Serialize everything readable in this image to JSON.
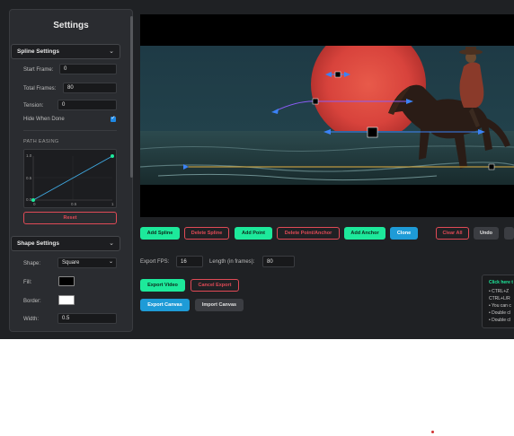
{
  "sidebar": {
    "title": "Settings",
    "spline_settings": {
      "header": "Spline Settings",
      "start_frame_label": "Start Frame:",
      "start_frame_value": "0",
      "total_frames_label": "Total Frames:",
      "total_frames_value": "80",
      "tension_label": "Tension:",
      "tension_value": "0",
      "hide_when_done_label": "Hide When Done",
      "path_easing_label": "PATH EASING",
      "graph_y_ticks": [
        "1.0",
        "0.5",
        "0.0"
      ],
      "graph_x_ticks": [
        "0",
        "0.5",
        "1"
      ],
      "easing_start": [
        0,
        0
      ],
      "easing_end": [
        1,
        1
      ],
      "reset_label": "Reset"
    },
    "shape_settings": {
      "header": "Shape Settings",
      "shape_label": "Shape:",
      "shape_value": "Square",
      "fill_label": "Fill:",
      "fill_color": "#000000",
      "border_label": "Border:",
      "border_color": "#ffffff",
      "width_label": "Width:",
      "width_value": "0.5"
    }
  },
  "toolbar": {
    "add_spline": "Add Spline",
    "delete_spline": "Delete Spline",
    "add_point": "Add Point",
    "delete_point_anchor": "Delete Point/Anchor",
    "add_anchor": "Add Anchor",
    "clone": "Clone",
    "clear_all": "Clear All",
    "undo": "Undo"
  },
  "export": {
    "fps_label": "Export FPS:",
    "fps_value": "16",
    "length_label": "Length (in frames):",
    "length_value": "80",
    "export_video": "Export Video",
    "cancel_export": "Cancel Export",
    "export_canvas": "Export Canvas",
    "import_canvas": "Import Canvas"
  },
  "help": {
    "heading": "Click here t",
    "lines": [
      "• CTRL+Z",
      "CTRL+L/R",
      "• You can c",
      "• Double cl",
      "• Double cl"
    ]
  },
  "colors": {
    "accent_green": "#1de99b",
    "accent_blue": "#1e9bd7",
    "accent_red": "#e04a56",
    "background": "#1f2124"
  }
}
